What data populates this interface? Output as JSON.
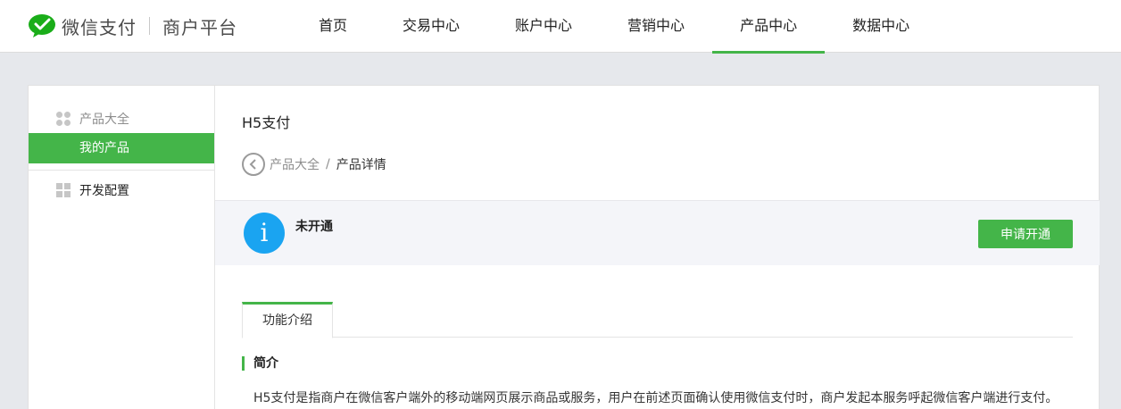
{
  "header": {
    "brand": "微信支付",
    "sub_brand": "商户平台",
    "nav": [
      {
        "label": "首页",
        "active": false
      },
      {
        "label": "交易中心",
        "active": false
      },
      {
        "label": "账户中心",
        "active": false
      },
      {
        "label": "营销中心",
        "active": false
      },
      {
        "label": "产品中心",
        "active": true
      },
      {
        "label": "数据中心",
        "active": false
      }
    ]
  },
  "sidebar": {
    "group_products": "产品大全",
    "active_item": "我的产品",
    "group_dev": "开发配置"
  },
  "main": {
    "title": "H5支付",
    "breadcrumb": {
      "parent": "产品大全",
      "separator": "/",
      "current": "产品详情"
    },
    "status": {
      "text": "未开通",
      "icon": "info-icon",
      "icon_glyph": "i"
    },
    "apply_button": "申请开通",
    "tab": "功能介绍",
    "section_title": "简介",
    "description": "H5支付是指商户在微信客户端外的移动端网页展示商品或服务，用户在前述页面确认使用微信支付时，商户发起本服务呼起微信客户端进行支付。"
  },
  "colors": {
    "accent": "#44b549",
    "info": "#1aa4f1",
    "logo": "#1aad19"
  }
}
